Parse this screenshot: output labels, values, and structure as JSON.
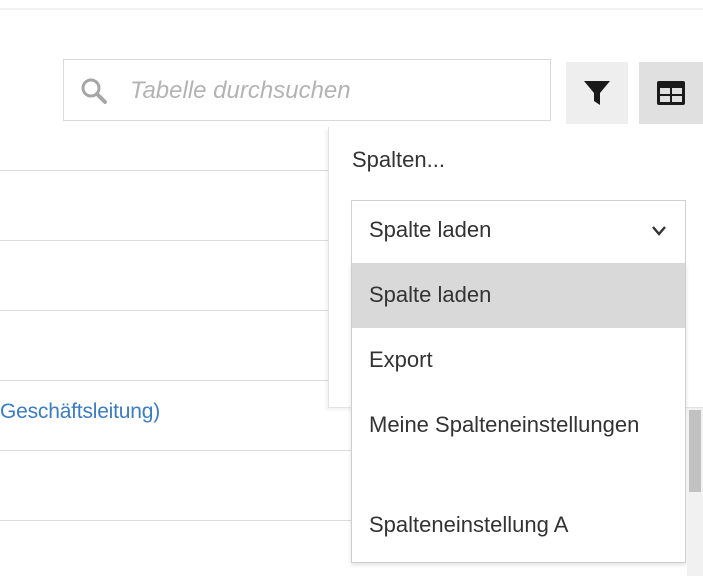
{
  "search": {
    "placeholder": "Tabelle durchsuchen",
    "value": ""
  },
  "toolbar": {
    "filter_icon": "funnel-icon",
    "columns_icon": "table-icon"
  },
  "table": {
    "visible_link": "Geschäftsleitung)"
  },
  "column_panel": {
    "title": "Spalten...",
    "select_value": "Spalte laden",
    "options": [
      "Spalte laden",
      "Export",
      "Meine Spalteneinstellungen",
      "Spalteneinstellung A"
    ],
    "selected_index": 0
  }
}
